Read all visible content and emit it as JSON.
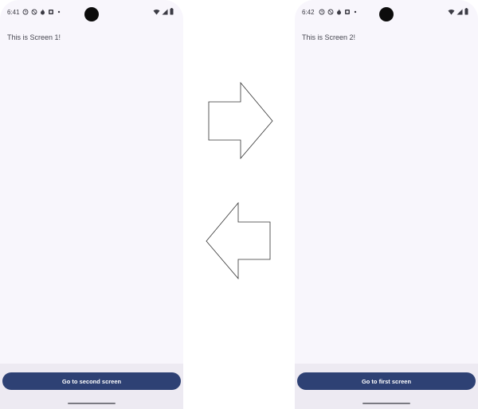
{
  "screen1": {
    "time": "6:41",
    "text": "This is  Screen 1!",
    "button_label": "Go to second screen"
  },
  "screen2": {
    "time": "6:42",
    "text": "This is  Screen 2!",
    "button_label": "Go to first screen"
  },
  "colors": {
    "background": "#f8f6fc",
    "button": "#2e4174",
    "bottom_bar": "#edeaf2"
  },
  "icons": [
    "alarm-icon",
    "do-not-disturb-icon",
    "fire-icon",
    "notification-icon",
    "dot-icon",
    "wifi-icon",
    "signal-icon",
    "battery-icon",
    "arrow-right-icon",
    "arrow-left-icon"
  ]
}
